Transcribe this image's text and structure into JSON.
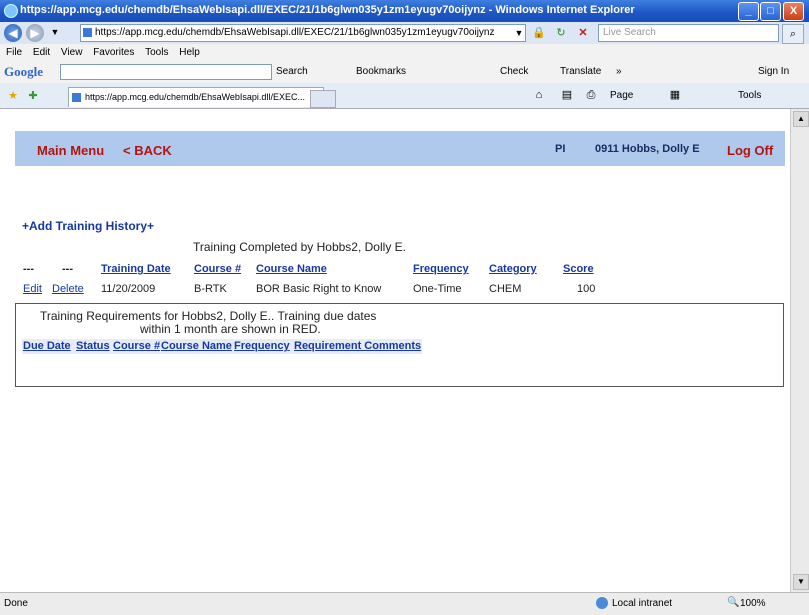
{
  "window": {
    "title": "https://app.mcg.edu/chemdb/EhsaWebIsapi.dll/EXEC/21/1b6glwn035y1zm1eyugv70oijynz - Windows Internet Explorer",
    "controls": [
      "_",
      "□",
      "X"
    ]
  },
  "address_bar": {
    "url": "https://app.mcg.edu/chemdb/EhsaWebIsapi.dll/EXEC/21/1b6glwn035y1zm1eyugv70oijynz",
    "search_placeholder": "Live Search"
  },
  "menu": [
    "File",
    "Edit",
    "View",
    "Favorites",
    "Tools",
    "Help"
  ],
  "google_toolbar": {
    "logo": "Google",
    "search": "Search",
    "bookmarks": "Bookmarks",
    "check": "Check",
    "translate": "Translate",
    "more": "»",
    "sign_in": "Sign In"
  },
  "tab": {
    "label": "https://app.mcg.edu/chemdb/EhsaWebIsapi.dll/EXEC...",
    "page_menu": "Page",
    "tools_menu": "Tools"
  },
  "header": {
    "main_menu": "Main Menu",
    "back": "< BACK",
    "role": "PI",
    "user": "0911  Hobbs, Dolly E",
    "logoff": "Log Off"
  },
  "history": {
    "add_link": "+Add Training History+",
    "caption": "Training Completed by Hobbs2, Dolly E.",
    "columns": [
      "---",
      "---",
      "Training Date",
      "Course #",
      "Course Name",
      "Frequency",
      "Category",
      "Score"
    ],
    "rows": [
      {
        "edit": "Edit",
        "delete": "Delete",
        "date": "11/20/2009",
        "course": "B-RTK",
        "name": "BOR Basic Right to Know",
        "frequency": "One-Time",
        "category": "CHEM",
        "score": "100"
      }
    ]
  },
  "requirements": {
    "caption_line1": "Training Requirements for Hobbs2, Dolly E.. Training due dates",
    "caption_line2": "within 1 month are shown in RED.",
    "columns": [
      "Due Date",
      "Status",
      "Course #",
      "Course Name",
      "Frequency",
      "Requirement Comments"
    ]
  },
  "status_bar": {
    "status": "Done",
    "zone": "Local intranet",
    "zoom": "100%"
  }
}
